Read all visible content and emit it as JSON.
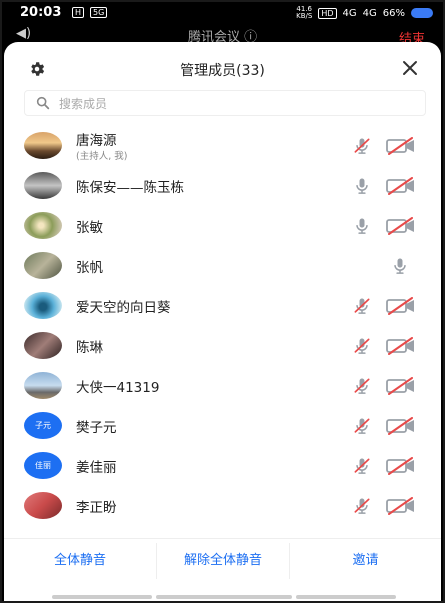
{
  "status": {
    "time": "20:03",
    "chip1": "H",
    "chip2": "5G",
    "speed_top": "41.6",
    "speed_bot": "KB/S",
    "hd": "HD",
    "sig1": "4G",
    "sig2": "4G",
    "battery": "66%"
  },
  "meeting": {
    "title": "腾讯会议 ⓘ",
    "end": "结束"
  },
  "header": {
    "title": "管理成员(33)"
  },
  "search": {
    "placeholder": "搜索成员"
  },
  "members": [
    {
      "name": "唐海源",
      "sub": "(主持人, 我)",
      "avatar": "photo",
      "mic": "muted",
      "cam": "off"
    },
    {
      "name": "陈保安——陈玉栋",
      "avatar": "photo",
      "mic": "on",
      "cam": "off"
    },
    {
      "name": "张敏",
      "avatar": "photo",
      "mic": "on",
      "cam": "off"
    },
    {
      "name": "张帆",
      "avatar": "photo",
      "mic": "on-only",
      "cam": "none"
    },
    {
      "name": "爱天空的向日葵",
      "avatar": "photo",
      "mic": "muted",
      "cam": "off"
    },
    {
      "name": "陈琳",
      "avatar": "photo",
      "mic": "muted",
      "cam": "off"
    },
    {
      "name": "大侠一41319",
      "avatar": "photo",
      "mic": "muted",
      "cam": "off"
    },
    {
      "name": "樊子元",
      "avatar_text": "子元",
      "mic": "muted",
      "cam": "off"
    },
    {
      "name": "姜佳丽",
      "avatar_text": "佳丽",
      "mic": "muted",
      "cam": "off"
    },
    {
      "name": "李正盼",
      "avatar": "photo",
      "mic": "muted",
      "cam": "off"
    }
  ],
  "footer": {
    "mute_all": "全体静音",
    "unmute_all": "解除全体静音",
    "invite": "邀请"
  },
  "colors": {
    "accent": "#1d6ff2",
    "end_red": "#e33333",
    "muted_red": "#e84a4a",
    "icon_gray": "#9aa0a8"
  }
}
